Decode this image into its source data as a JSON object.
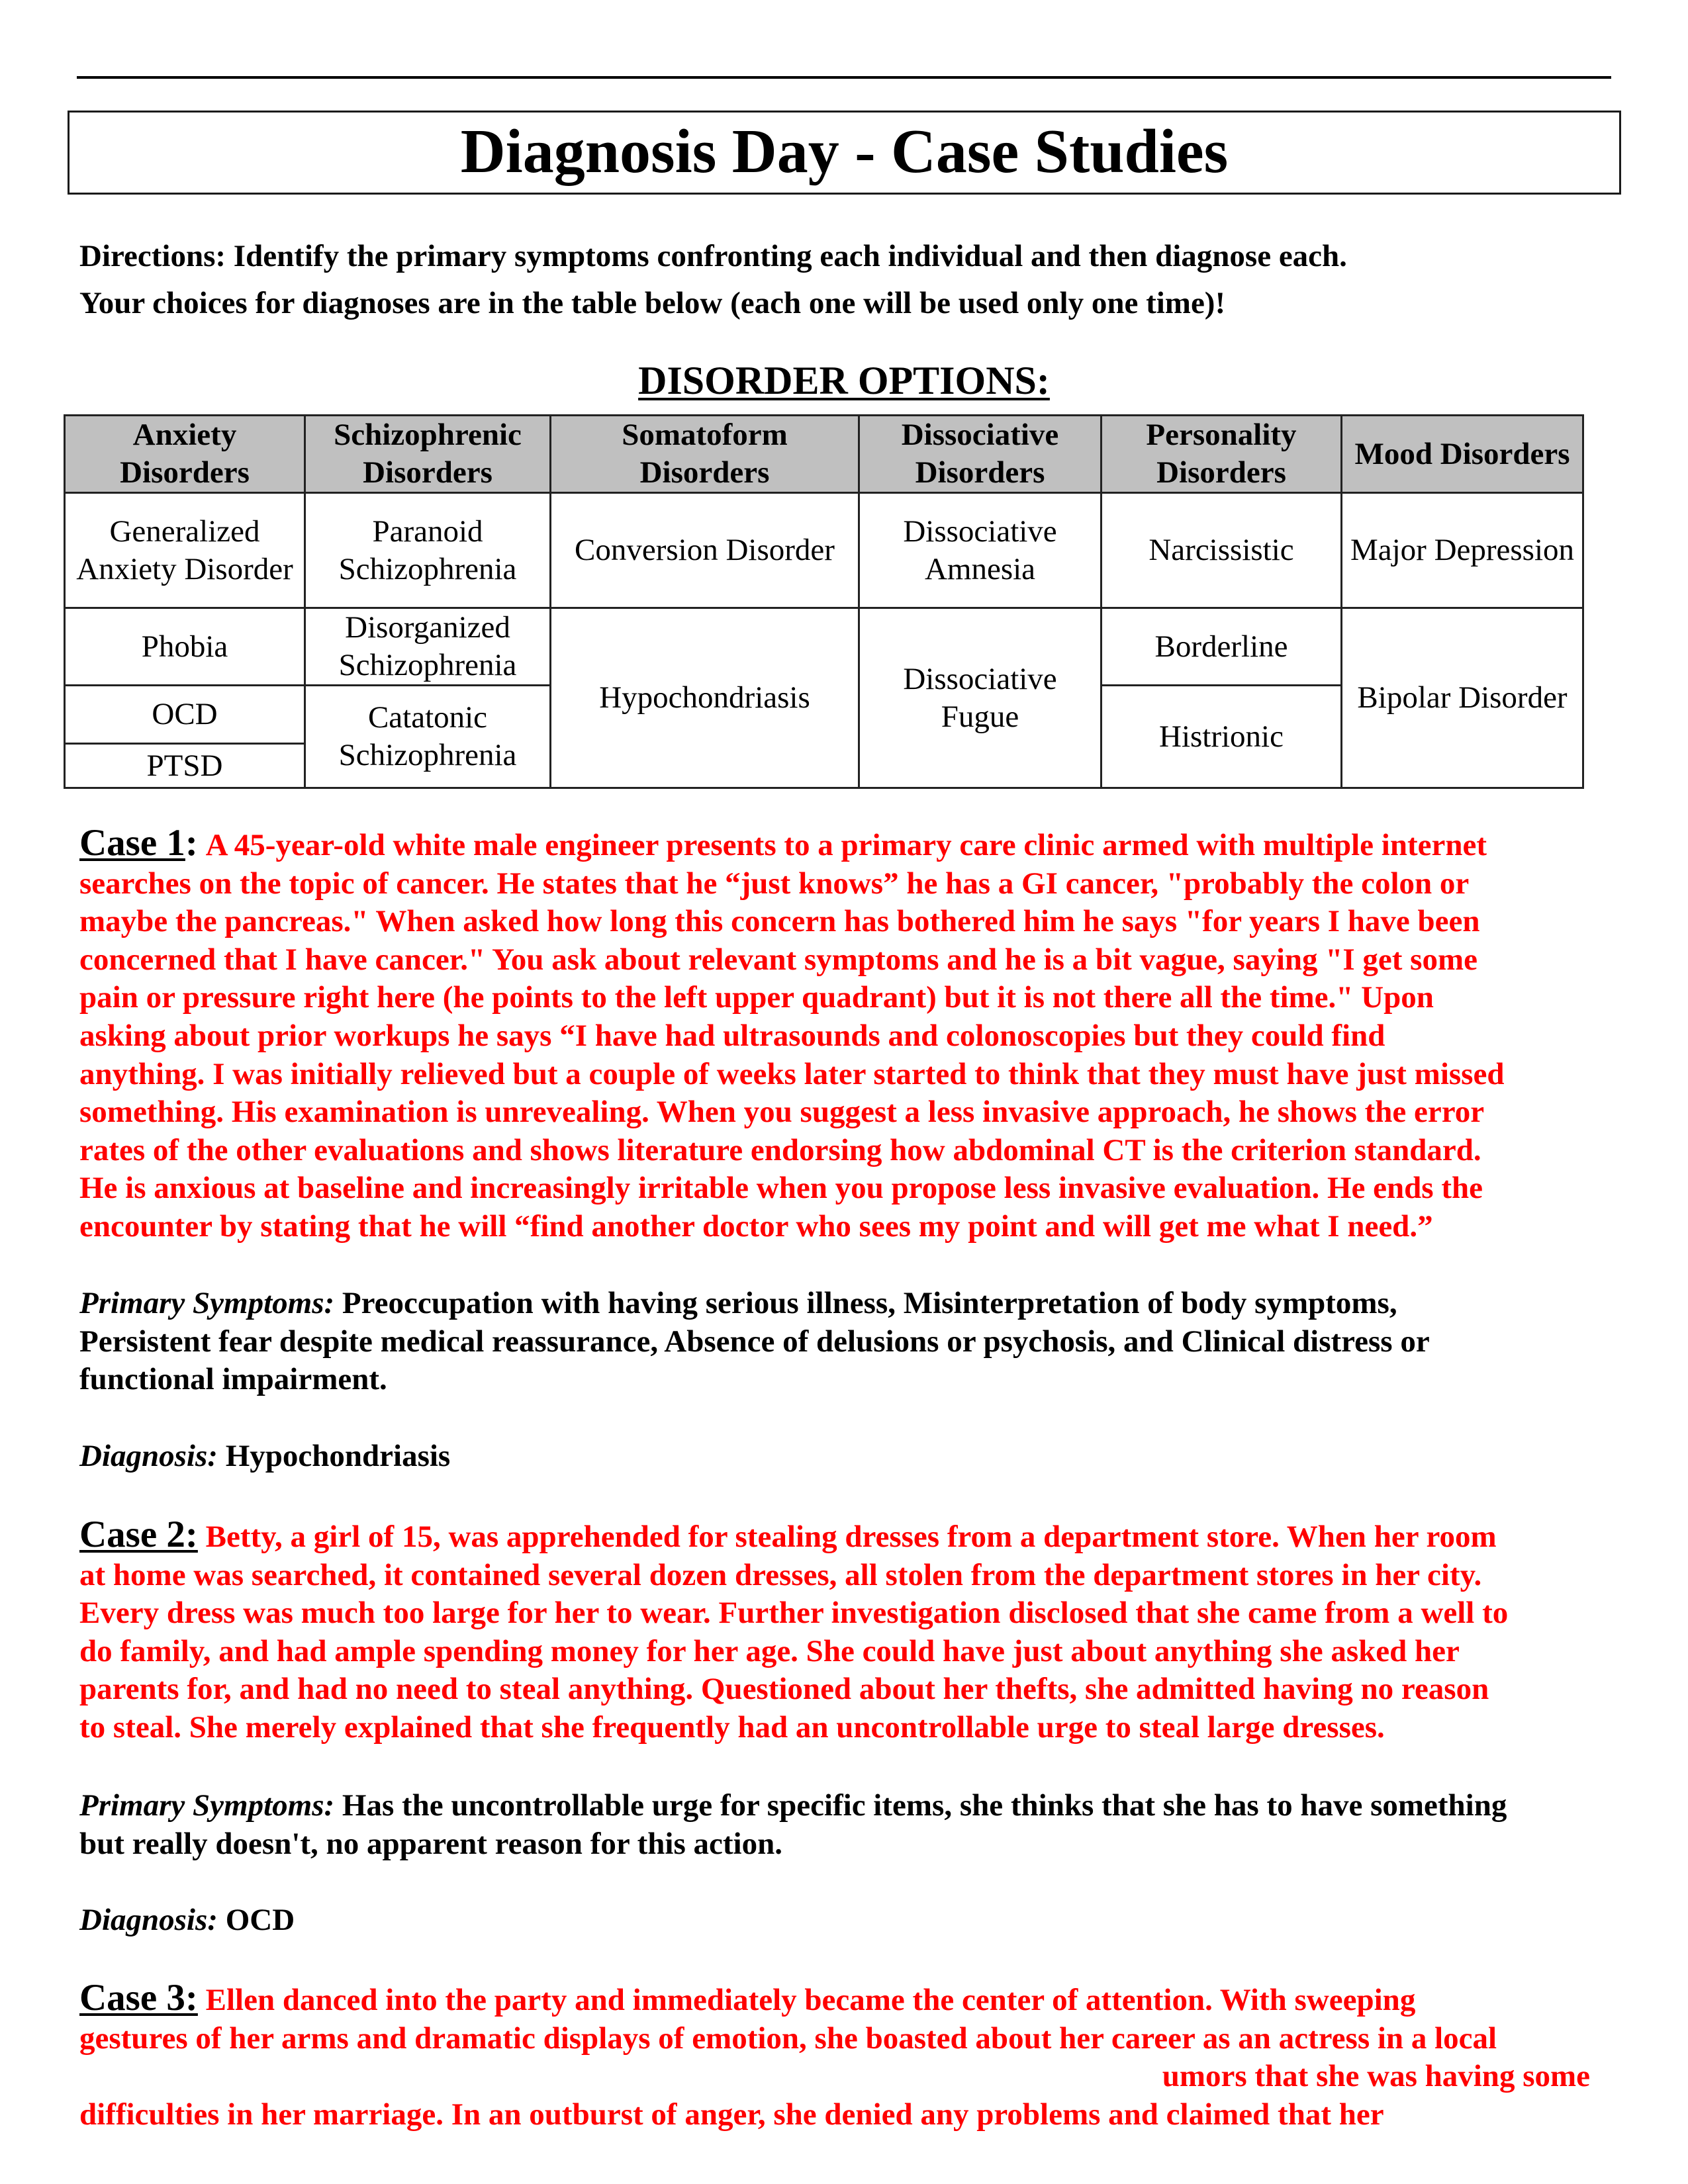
{
  "title": "Diagnosis Day - Case Studies",
  "directions": [
    "Directions: Identify the primary symptoms confronting each individual and then diagnose each.",
    "Your choices for diagnoses are in the table below (each one will be used only one time)!"
  ],
  "options_heading": "DISORDER OPTIONS:",
  "table": {
    "headers": [
      "Anxiety Disorders",
      "Schizophrenic Disorders",
      "Somatoform Disorders",
      "Dissociative Disorders",
      "Personality Disorders",
      "Mood Disorders"
    ],
    "anxiety": [
      "Generalized Anxiety Disorder",
      "Phobia",
      "OCD",
      "PTSD"
    ],
    "schizophrenic": [
      "Paranoid Schizophrenia",
      "Disorganized Schizophrenia",
      "Catatonic Schizophrenia"
    ],
    "somatoform": [
      "Conversion Disorder",
      "Hypochondriasis"
    ],
    "dissociative": [
      "Dissociative Amnesia",
      "Dissociative Fugue"
    ],
    "personality": [
      "Narcissistic",
      "Borderline",
      "Histrionic"
    ],
    "mood": [
      "Major Depression",
      "Bipolar Disorder"
    ]
  },
  "labels": {
    "primary_symptoms": "Primary Symptoms:",
    "diagnosis": "Diagnosis:"
  },
  "cases": [
    {
      "label": "Case 1",
      "colon": ":",
      "lines": [
        "A 45-year-old white male engineer presents to a primary care clinic armed with multiple internet",
        "searches on the topic of cancer. He states that he “just knows” he has a GI cancer, \"probably the colon or",
        "maybe the pancreas.\" When asked how long this concern has bothered him he says \"for years I have been",
        "concerned that I have cancer.\" You ask about relevant symptoms and he is a bit vague, saying \"I get some",
        "pain or pressure right here (he points to the left upper quadrant) but it is not there all the time.\" Upon",
        "asking about prior workups he says “I have had ultrasounds and colonoscopies but they could find",
        "anything. I was initially relieved but a couple of weeks later started to think that they must have just missed",
        "something. His examination is unrevealing. When you suggest a less invasive approach, he shows the error",
        "rates of the other evaluations and shows literature endorsing how abdominal CT is the criterion standard.",
        "He is anxious at baseline and increasingly irritable when you propose less invasive evaluation. He ends the",
        "encounter by stating that he will “find another doctor who sees my point and will get me what I need.”"
      ],
      "symptoms_lines": [
        "Preoccupation with having serious illness, Misinterpretation of body symptoms,",
        "Persistent fear despite medical reassurance, Absence of delusions or psychosis, and Clinical distress or",
        "functional impairment."
      ],
      "diagnosis": "Hypochondriasis"
    },
    {
      "label": "Case 2:",
      "colon": "",
      "lines": [
        "Betty, a girl of 15, was apprehended for stealing dresses from a department store.  When her room",
        "at home was searched, it contained several dozen dresses, all stolen from the department stores in her city.",
        "Every dress was much too large for her to wear.  Further investigation disclosed that she came from a well to",
        "do family, and had ample spending money for her age.  She could have just about anything she asked her",
        "parents for, and had no need to steal anything.  Questioned about her thefts, she admitted having no reason",
        "to steal.  She merely explained that she frequently had an uncontrollable urge to steal large dresses."
      ],
      "symptoms_lines": [
        "Has the uncontrollable urge for specific items, she thinks that she has to have something",
        "but really doesn't, no apparent reason for this action."
      ],
      "diagnosis": "OCD"
    },
    {
      "label": "Case 3:",
      "colon": "",
      "lines": [
        "Ellen danced into the party and immediately became the center of attention.  With sweeping",
        "gestures of her arms and dramatic displays of emotion, she boasted about her career as an actress in a local",
        "umors that she was having some",
        "difficulties in her marriage.  In an outburst of anger, she denied any problems and claimed that her"
      ]
    }
  ],
  "colors": {
    "case_text": "#ff0000",
    "header_bg": "#c0c0c0"
  }
}
